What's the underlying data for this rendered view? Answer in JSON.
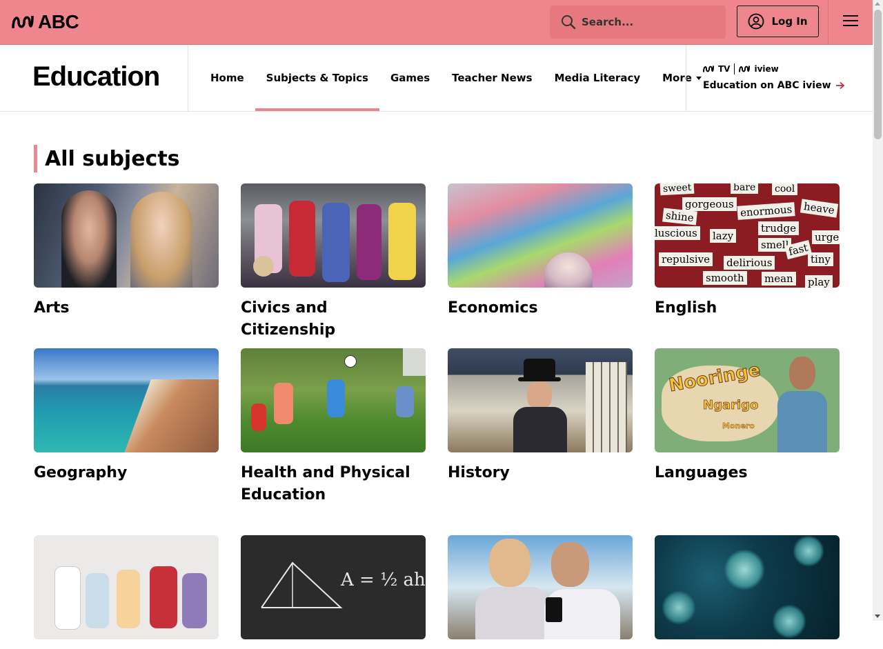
{
  "header": {
    "logo_text": "ABC",
    "search_placeholder": "Search...",
    "login_label": "Log In"
  },
  "section": {
    "title": "Education",
    "nav": [
      {
        "label": "Home",
        "active": false
      },
      {
        "label": "Subjects & Topics",
        "active": true
      },
      {
        "label": "Games",
        "active": false
      },
      {
        "label": "Teacher News",
        "active": false
      },
      {
        "label": "Media Literacy",
        "active": false
      },
      {
        "label": "More",
        "active": false
      }
    ],
    "promo": {
      "tv": "TV",
      "iview": "iview",
      "link_label": "Education on ABC iview"
    }
  },
  "main": {
    "heading": "All subjects",
    "cards": [
      {
        "label": "Arts"
      },
      {
        "label": "Civics and Citizenship"
      },
      {
        "label": "Economics"
      },
      {
        "label": "English"
      },
      {
        "label": "Geography"
      },
      {
        "label": "Health and Physical Education"
      },
      {
        "label": "History"
      },
      {
        "label": "Languages"
      },
      {
        "label": ""
      },
      {
        "label": ""
      },
      {
        "label": ""
      },
      {
        "label": ""
      }
    ],
    "english_words": [
      "sweet",
      "bare",
      "cool",
      "gorgeous",
      "enormous",
      "heave",
      "shine",
      "trudge",
      "luscious",
      "lazy",
      "smell",
      "urge",
      "fast",
      "repulsive",
      "delirious",
      "tiny",
      "smooth",
      "mean",
      "play"
    ],
    "languages_image_text": [
      "Nooringe",
      "Ngarigo",
      "Monero"
    ],
    "maths_formula": "A = ½ ah"
  },
  "colors": {
    "brand": "#f0868d",
    "search_bg": "#e6787f",
    "text": "#000000"
  }
}
